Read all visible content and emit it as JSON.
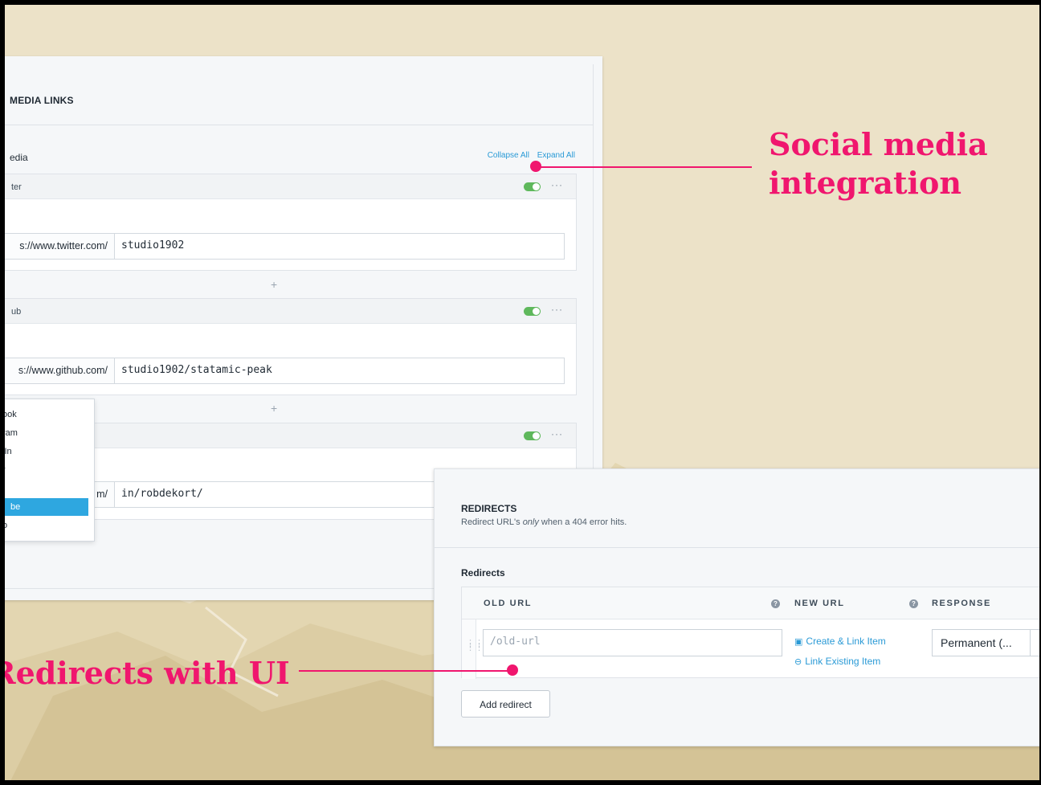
{
  "social": {
    "section_title": "MEDIA LINKS",
    "field_label": "edia",
    "collapse_all": "Collapse All",
    "expand_all": "Expand All",
    "sets": [
      {
        "name": "ter",
        "prefix": "s://www.twitter.com/",
        "value": "studio1902",
        "enabled": true
      },
      {
        "name": "ub",
        "prefix": "s://www.github.com/",
        "value": "studio1902/statamic-peak",
        "enabled": true
      },
      {
        "name": "",
        "prefix": "m/",
        "value": "in/robdekort/",
        "enabled": true
      }
    ],
    "menu_icon": "···",
    "add_icon": "+",
    "dropdown_options": [
      "ook",
      "ram",
      "lIn",
      "r",
      "",
      "be",
      "o"
    ],
    "dropdown_selected_index": 5
  },
  "redirects": {
    "title": "REDIRECTS",
    "subtitle_before": "Redirect URL's ",
    "subtitle_em": "only",
    "subtitle_after": " when a 404 error hits.",
    "field_label": "Redirects",
    "columns": {
      "old_url": "OLD URL",
      "new_url": "NEW URL",
      "response": "RESPONSE"
    },
    "help_icon": "?",
    "old_url_placeholder": "/old-url",
    "create_link": "Create & Link Item",
    "link_existing": "Link Existing Item",
    "response_value": "Permanent (...",
    "add_button": "Add redirect"
  },
  "callouts": {
    "social": "Social media integration",
    "redirects": "Redirects with UI"
  },
  "colors": {
    "accent": "#f0166e",
    "link": "#2a9ad6",
    "toggle_on": "#5fb85c",
    "selected": "#2ea7e0",
    "background": "#ece2c8"
  }
}
